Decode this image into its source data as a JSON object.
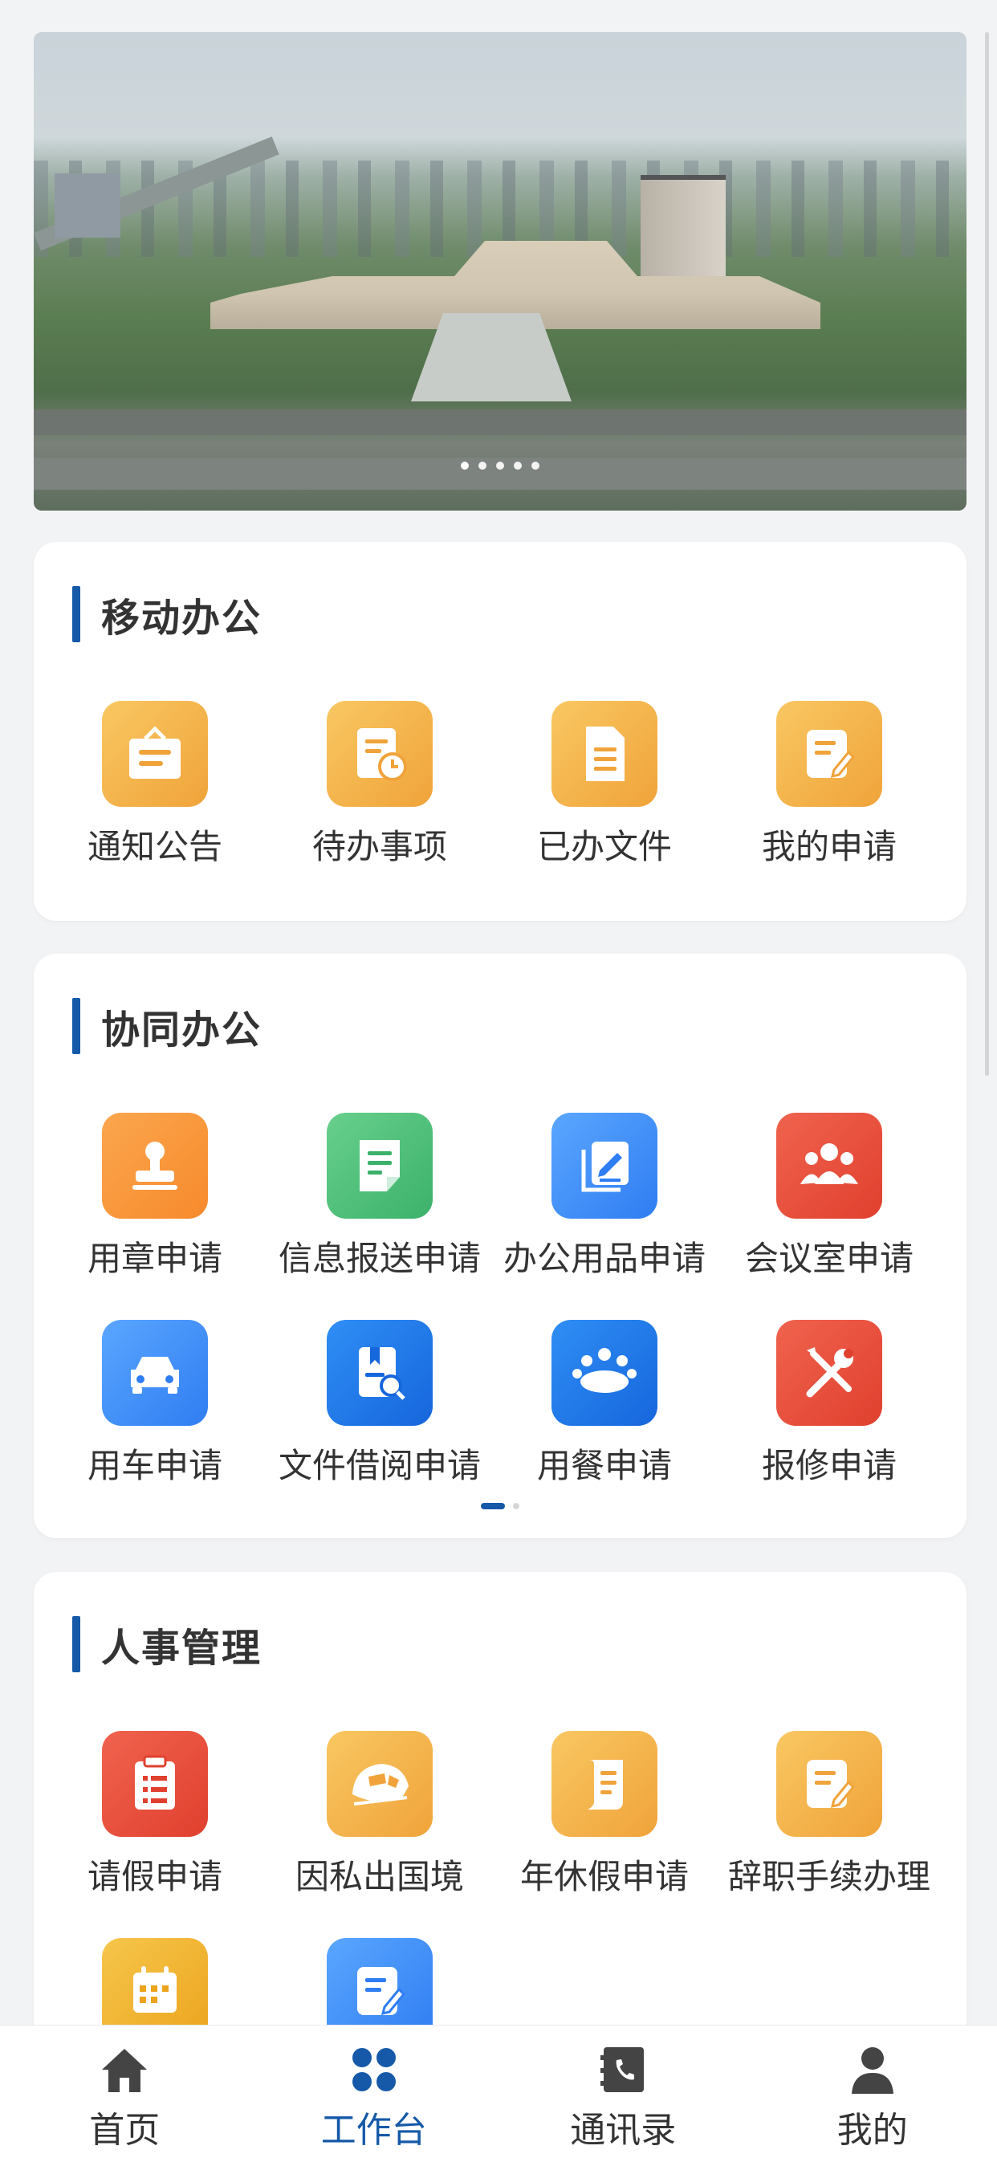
{
  "banner": {
    "slides": 5,
    "active_slide": 1
  },
  "sections": [
    {
      "title": "移动办公",
      "items": [
        {
          "label": "通知公告",
          "icon": "notice-board-icon",
          "color": "#f0a33a"
        },
        {
          "label": "待办事项",
          "icon": "todo-clock-icon",
          "color": "#f0a33a"
        },
        {
          "label": "已办文件",
          "icon": "document-icon",
          "color": "#f0a33a"
        },
        {
          "label": "我的申请",
          "icon": "edit-form-icon",
          "color": "#f0a33a"
        }
      ]
    },
    {
      "title": "协同办公",
      "items": [
        {
          "label": "用章申请",
          "icon": "stamp-icon",
          "color": "#f78a2c"
        },
        {
          "label": "信息报送申请",
          "icon": "report-doc-icon",
          "color": "#3cb16a"
        },
        {
          "label": "办公用品申请",
          "icon": "supplies-icon",
          "color": "#2f7df2"
        },
        {
          "label": "会议室申请",
          "icon": "meeting-people-icon",
          "color": "#e0402e"
        },
        {
          "label": "用车申请",
          "icon": "car-icon",
          "color": "#2f7df2"
        },
        {
          "label": "文件借阅申请",
          "icon": "borrow-doc-icon",
          "color": "#1666dc"
        },
        {
          "label": "用餐申请",
          "icon": "dining-group-icon",
          "color": "#1666dc"
        },
        {
          "label": "报修申请",
          "icon": "repair-tools-icon",
          "color": "#e0402e"
        }
      ],
      "pages": 2,
      "active_page": 1
    },
    {
      "title": "人事管理",
      "items": [
        {
          "label": "请假申请",
          "icon": "leave-clipboard-icon",
          "color": "#e0402e"
        },
        {
          "label": "因私出国境",
          "icon": "travel-train-icon",
          "color": "#f0a33a"
        },
        {
          "label": "年休假申请",
          "icon": "scroll-icon",
          "color": "#f0a33a"
        },
        {
          "label": "辞职手续办理",
          "icon": "edit-form-icon",
          "color": "#f0a33a"
        },
        {
          "label": "",
          "icon": "calendar-icon",
          "color": "#eca41d"
        },
        {
          "label": "",
          "icon": "edit-note-icon",
          "color": "#2f7df2"
        }
      ]
    }
  ],
  "tabbar": {
    "active": 1,
    "items": [
      {
        "label": "首页",
        "icon": "home-icon"
      },
      {
        "label": "工作台",
        "icon": "workbench-icon"
      },
      {
        "label": "通讯录",
        "icon": "contacts-icon"
      },
      {
        "label": "我的",
        "icon": "user-icon"
      }
    ]
  }
}
